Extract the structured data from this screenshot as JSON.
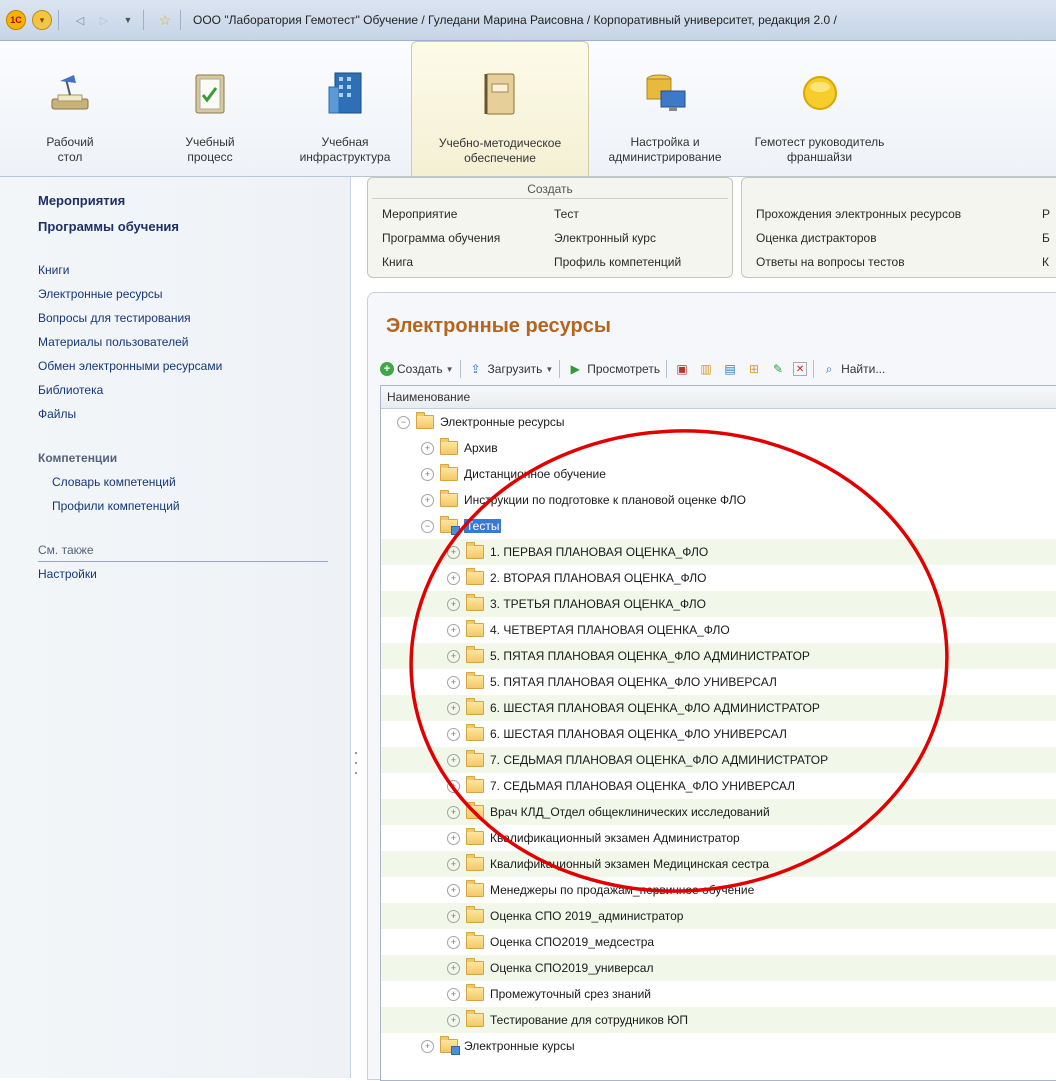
{
  "window": {
    "title": "ООО \"Лаборатория Гемотест\" Обучение / Гуледани Марина Раисовна / Корпоративный университет, редакция 2.0 /"
  },
  "sections": [
    {
      "label": "Рабочий\nстол",
      "icon": "desk-lamp-icon"
    },
    {
      "label": "Учебный\nпроцесс",
      "icon": "clipboard-icon"
    },
    {
      "label": "Учебная\nинфраструктура",
      "icon": "building-icon"
    },
    {
      "label": "Учебно-методическое\nобеспечение",
      "icon": "binder-icon",
      "active": true
    },
    {
      "label": "Настройка и\nадминистрирование",
      "icon": "database-monitor-icon"
    },
    {
      "label": "Гемотест руководитель\nфраншайзи",
      "icon": "yellow-circle-icon"
    }
  ],
  "nav": {
    "events": "Мероприятия",
    "programs": "Программы обучения",
    "books": "Книги",
    "eresources": "Электронные ресурсы",
    "questions": "Вопросы для тестирования",
    "user_materials": "Материалы пользователей",
    "exchange": "Обмен электронными ресурсами",
    "library": "Библиотека",
    "files": "Файлы",
    "competencies_group": "Компетенции",
    "comp_dictionary": "Словарь компетенций",
    "comp_profiles": "Профили компетенций",
    "see_also": "См. также",
    "settings": "Настройки"
  },
  "create_panel": {
    "header": "Создать",
    "col1": [
      "Мероприятие",
      "Программа обучения",
      "Книга"
    ],
    "col2": [
      "Тест",
      "Электронный курс",
      "Профиль компетенций"
    ]
  },
  "reports_panel": {
    "col1": [
      "Прохождения электронных ресурсов",
      "Оценка дистракторов",
      "Ответы на вопросы тестов"
    ],
    "col2": [
      "Р",
      "Б",
      "К"
    ]
  },
  "form": {
    "title": "Электронные ресурсы",
    "toolbar": {
      "create": "Создать",
      "upload": "Загрузить",
      "view": "Просмотреть",
      "find": "Найти..."
    },
    "column_header": "Наименование"
  },
  "tree": [
    {
      "label": "Электронные ресурсы",
      "level": 0,
      "state": "-",
      "alt": false
    },
    {
      "label": "Архив",
      "level": 1,
      "state": "+",
      "alt": false
    },
    {
      "label": "Дистанционное обучение",
      "level": 1,
      "state": "+",
      "alt": false
    },
    {
      "label": "Инструкции по подготовке к плановой оценке ФЛО",
      "level": 1,
      "state": "+",
      "alt": false
    },
    {
      "label": "Тесты",
      "level": 1,
      "state": "-",
      "alt": false,
      "selected": true,
      "special": true
    },
    {
      "label": "1. ПЕРВАЯ ПЛАНОВАЯ ОЦЕНКА_ФЛО",
      "level": 2,
      "state": "+",
      "alt": true
    },
    {
      "label": "2. ВТОРАЯ ПЛАНОВАЯ ОЦЕНКА_ФЛО",
      "level": 2,
      "state": "+",
      "alt": false
    },
    {
      "label": "3. ТРЕТЬЯ ПЛАНОВАЯ ОЦЕНКА_ФЛО",
      "level": 2,
      "state": "+",
      "alt": true
    },
    {
      "label": "4. ЧЕТВЕРТАЯ ПЛАНОВАЯ ОЦЕНКА_ФЛО",
      "level": 2,
      "state": "+",
      "alt": false
    },
    {
      "label": "5. ПЯТАЯ ПЛАНОВАЯ ОЦЕНКА_ФЛО АДМИНИСТРАТОР",
      "level": 2,
      "state": "+",
      "alt": true
    },
    {
      "label": "5. ПЯТАЯ ПЛАНОВАЯ ОЦЕНКА_ФЛО УНИВЕРСАЛ",
      "level": 2,
      "state": "+",
      "alt": false
    },
    {
      "label": "6. ШЕСТАЯ ПЛАНОВАЯ ОЦЕНКА_ФЛО АДМИНИСТРАТОР",
      "level": 2,
      "state": "+",
      "alt": true
    },
    {
      "label": "6. ШЕСТАЯ ПЛАНОВАЯ ОЦЕНКА_ФЛО УНИВЕРСАЛ",
      "level": 2,
      "state": "+",
      "alt": false
    },
    {
      "label": "7. СЕДЬМАЯ ПЛАНОВАЯ ОЦЕНКА_ФЛО АДМИНИСТРАТОР",
      "level": 2,
      "state": "+",
      "alt": true
    },
    {
      "label": "7. СЕДЬМАЯ ПЛАНОВАЯ ОЦЕНКА_ФЛО УНИВЕРСАЛ",
      "level": 2,
      "state": "+",
      "alt": false
    },
    {
      "label": "Врач КЛД_Отдел общеклинических исследований",
      "level": 2,
      "state": "+",
      "alt": true
    },
    {
      "label": "Квалификационный экзамен Администратор",
      "level": 2,
      "state": "+",
      "alt": false
    },
    {
      "label": "Квалификационный экзамен Медицинская сестра",
      "level": 2,
      "state": "+",
      "alt": true
    },
    {
      "label": "Менеджеры по продажам_первичное обучение",
      "level": 2,
      "state": "+",
      "alt": false
    },
    {
      "label": "Оценка СПО 2019_администратор",
      "level": 2,
      "state": "+",
      "alt": true
    },
    {
      "label": "Оценка СПО2019_медсестра",
      "level": 2,
      "state": "+",
      "alt": false
    },
    {
      "label": "Оценка СПО2019_универсал",
      "level": 2,
      "state": "+",
      "alt": true
    },
    {
      "label": "Промежуточный срез знаний",
      "level": 2,
      "state": "+",
      "alt": false
    },
    {
      "label": "Тестирование для сотрудников ЮП",
      "level": 2,
      "state": "+",
      "alt": true
    },
    {
      "label": "Электронные курсы",
      "level": 1,
      "state": "+",
      "alt": false,
      "special": true
    }
  ],
  "colors": {
    "title_orange": "#b5651d",
    "row_alt": "#f1f7e9",
    "selection": "#3a78d6",
    "annotation_red": "#e00000"
  }
}
